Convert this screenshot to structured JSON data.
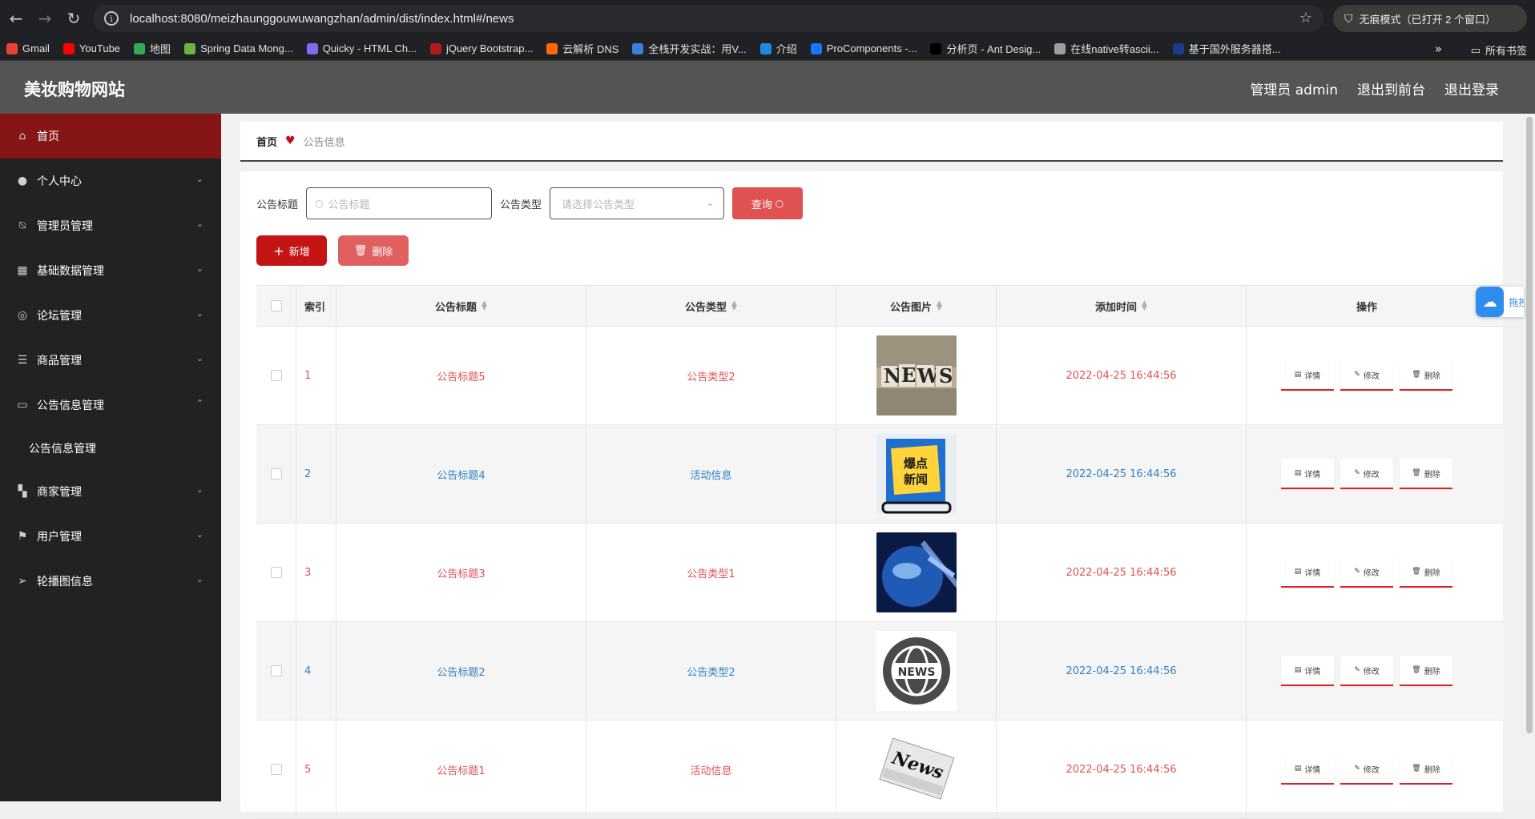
{
  "browser": {
    "url": "localhost:8080/meizhaunggouwuwangzhan/admin/dist/index.html#/news",
    "incognito_label": "无痕模式（已打开 2 个窗口）",
    "bookmarks": [
      {
        "label": "Gmail",
        "color": "#ea4335"
      },
      {
        "label": "YouTube",
        "color": "#ff0000"
      },
      {
        "label": "地图",
        "color": "#34a853"
      },
      {
        "label": "Spring Data Mong...",
        "color": "#6db33f"
      },
      {
        "label": "Quicky - HTML Ch...",
        "color": "#7c6cf0"
      },
      {
        "label": "jQuery Bootstrap...",
        "color": "#b31b1b"
      },
      {
        "label": "云解析 DNS",
        "color": "#ff6a00"
      },
      {
        "label": "全栈开发实战：用V...",
        "color": "#3d7de0"
      },
      {
        "label": "介绍",
        "color": "#1e88e5"
      },
      {
        "label": "ProComponents -...",
        "color": "#1677ff"
      },
      {
        "label": "分析页 - Ant Desig...",
        "color": "#000000"
      },
      {
        "label": "在线native转ascii...",
        "color": "#9e9e9e"
      },
      {
        "label": "基于国外服务器搭...",
        "color": "#1a3a8a"
      }
    ],
    "more": "»",
    "all_bookmarks": "所有书签"
  },
  "header": {
    "brand": "美妆购物网站",
    "links": [
      "管理员 admin",
      "退出到前台",
      "退出登录"
    ]
  },
  "sidebar": {
    "items": [
      {
        "label": "首页",
        "icon": "home-icon",
        "glyph": "⌂",
        "active": true,
        "arrow": ""
      },
      {
        "label": "个人中心",
        "icon": "user-icon",
        "glyph": "●",
        "arrow": "⌄"
      },
      {
        "label": "管理员管理",
        "icon": "bell-off-icon",
        "glyph": "⍉",
        "arrow": "⌄"
      },
      {
        "label": "基础数据管理",
        "icon": "grid-icon",
        "glyph": "▦",
        "arrow": "⌄"
      },
      {
        "label": "论坛管理",
        "icon": "compass-icon",
        "glyph": "◎",
        "arrow": "⌄"
      },
      {
        "label": "商品管理",
        "icon": "list-icon",
        "glyph": "☰",
        "arrow": "⌄"
      },
      {
        "label": "公告信息管理",
        "icon": "message-icon",
        "glyph": "▭",
        "arrow": "⌃",
        "open": true
      }
    ],
    "submenu": [
      "公告信息管理"
    ],
    "items_after": [
      {
        "label": "商家管理",
        "icon": "menu-grid-icon",
        "glyph": "▚",
        "arrow": "⌄"
      },
      {
        "label": "用户管理",
        "icon": "flag-icon",
        "glyph": "⚑",
        "arrow": "⌄"
      },
      {
        "label": "轮播图信息",
        "icon": "send-icon",
        "glyph": "➢",
        "arrow": "⌄"
      }
    ]
  },
  "breadcrumb": {
    "home": "首页",
    "current": "公告信息"
  },
  "search": {
    "title_label": "公告标题",
    "title_placeholder": "公告标题",
    "type_label": "公告类型",
    "type_placeholder": "请选择公告类型",
    "query_button": "查询"
  },
  "actions": {
    "add": "新增",
    "delete": "删除"
  },
  "table": {
    "headers": [
      "索引",
      "公告标题",
      "公告类型",
      "公告图片",
      "添加时间",
      "操作"
    ],
    "rows": [
      {
        "index": "1",
        "title": "公告标题5",
        "type": "公告类型2",
        "time": "2022-04-25 16:44:56",
        "image": "news-cubes"
      },
      {
        "index": "2",
        "title": "公告标题4",
        "type": "活动信息",
        "time": "2022-04-25 16:44:56",
        "image": "breaking-news-phone"
      },
      {
        "index": "3",
        "title": "公告标题3",
        "type": "公告类型1",
        "time": "2022-04-25 16:44:56",
        "image": "globe-news"
      },
      {
        "index": "4",
        "title": "公告标题2",
        "type": "公告类型2",
        "time": "2022-04-25 16:44:56",
        "image": "news-globe-badge"
      },
      {
        "index": "5",
        "title": "公告标题1",
        "type": "活动信息",
        "time": "2022-04-25 16:44:56",
        "image": "newspaper"
      }
    ],
    "ops": [
      "详情",
      "修改",
      "删除"
    ]
  },
  "float_widget": {
    "label": "拖拽"
  },
  "colors": {
    "accent_red": "#c51414",
    "row_red": "#e05252",
    "row_blue": "#2f80c4",
    "sidebar_active": "#861515"
  }
}
